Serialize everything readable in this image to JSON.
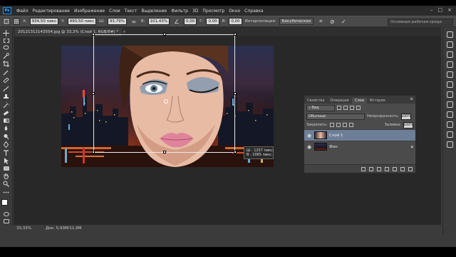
{
  "menubar": {
    "logo": "Ps",
    "items": [
      "Файл",
      "Редактирование",
      "Изображение",
      "Слои",
      "Текст",
      "Выделение",
      "Фильтр",
      "3D",
      "Просмотр",
      "Окно",
      "Справка"
    ],
    "window_controls": [
      "–",
      "□",
      "×"
    ]
  },
  "options": {
    "x_label": "X:",
    "x_value": "934,50 пикс",
    "y_label": "Y:",
    "y_value": "490,50 пикс",
    "w_label": "Ш:",
    "w_value": "93,79%",
    "h_label": "В:",
    "h_value": "101,43%",
    "angle_value": "0,00",
    "hskew_label": "Г:",
    "hskew_value": "0,00",
    "vskew_label": "В:",
    "vskew_value": "0,00",
    "interp_label": "Интерполяция:",
    "interp_value": "Бикубическая",
    "cancel_glyph": "⊘",
    "commit_glyph": "✓",
    "workspace": "Основная рабочая среда"
  },
  "document": {
    "tab_title": "20121312143554.jpg @ 33,3% (Слой 1, RGB/8#) *",
    "tab_close": "×",
    "zoom": "33,33%",
    "doc_size": "Док: 5,93М/11,9М"
  },
  "transform_tip": {
    "w_line": "Ш : 1257 пикс.",
    "h_line": "В : 1065 пикс."
  },
  "layers_panel": {
    "tabs": [
      "Свойства",
      "Операции",
      "Слои",
      "История"
    ],
    "active_tab": 2,
    "filter_label": "Вид",
    "blend_mode": "Обычные",
    "opacity_label": "Непрозрачность:",
    "opacity_value": "100%",
    "lock_label": "Закрепить:",
    "fill_label": "Заливка:",
    "fill_value": "100%",
    "layers": [
      {
        "name": "Слой 1",
        "visible": true,
        "selected": true
      },
      {
        "name": "Фон",
        "visible": true,
        "selected": false,
        "locked": true
      }
    ]
  },
  "colors": {
    "menubar_bg": "#2b2b2b",
    "workspace_bg": "#282828",
    "panel_bg": "#4b4b4b",
    "selected_layer": "#6d7f98"
  }
}
